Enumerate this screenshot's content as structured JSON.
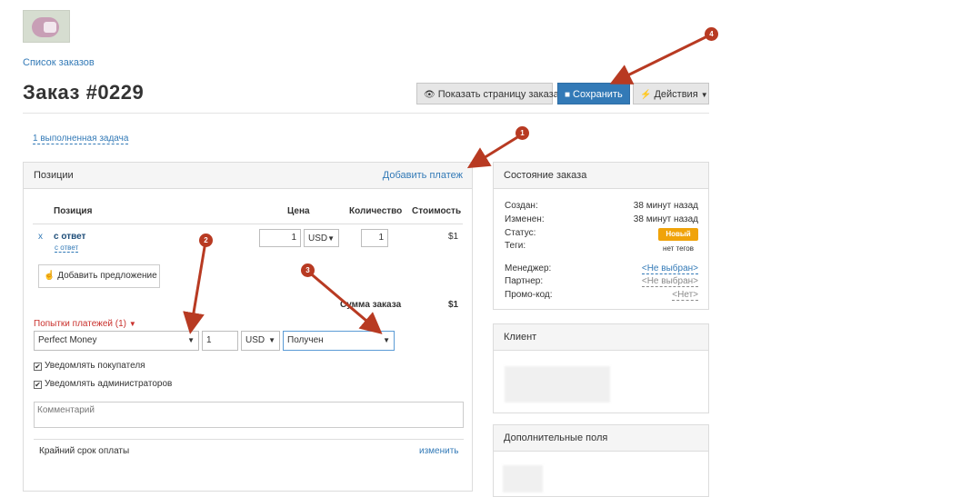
{
  "breadcrumb": "Список заказов",
  "title": "Заказ #0229",
  "toolbar": {
    "show_order_page": "Показать страницу заказа",
    "save": "Сохранить",
    "actions": "Действия"
  },
  "task_link": "1 выполненная задача",
  "items_panel": {
    "heading": "Позиции",
    "add_payment": "Добавить платеж",
    "columns": [
      "Позиция",
      "Цена",
      "Количество",
      "Стоимость"
    ],
    "rows": [
      {
        "remove": "x",
        "name": "с ответ",
        "sublabel": "с ответ",
        "price": "1",
        "currency": "USD",
        "qty": "1",
        "cost": "$1"
      }
    ],
    "add_offer": "Добавить предложение",
    "total_label": "Сумма заказа",
    "total_value": "$1",
    "payment_attempts": "Попытки платежей (1)",
    "payment": {
      "method": "Perfect Money",
      "amount": "1",
      "currency": "USD",
      "status": "Получен"
    },
    "notify_buyer": "Уведомлять покупателя",
    "notify_admins": "Уведомлять администраторов",
    "comment_placeholder": "Комментарий",
    "due_label": "Крайний срок оплаты",
    "due_edit": "изменить"
  },
  "state_panel": {
    "heading": "Состояние заказа",
    "created_label": "Создан:",
    "created_value": "38 минут назад",
    "changed_label": "Изменен:",
    "changed_value": "38 минут назад",
    "status_label": "Статус:",
    "status_value": "Новый",
    "tags_label": "Теги:",
    "tags_value": "нет тегов",
    "manager_label": "Менеджер:",
    "manager_value": "<Не выбран>",
    "partner_label": "Партнер:",
    "partner_value": "<Не выбран>",
    "promo_label": "Промо-код:",
    "promo_value": "<Нет>"
  },
  "client_panel": {
    "heading": "Клиент"
  },
  "extra_panel": {
    "heading": "Дополнительные поля"
  },
  "annotations": [
    "1",
    "2",
    "3",
    "4"
  ],
  "colors": {
    "primary": "#337ab7",
    "annotation": "#b83a22",
    "status_badge": "#f0a30a",
    "attempts": "#c9302c"
  }
}
